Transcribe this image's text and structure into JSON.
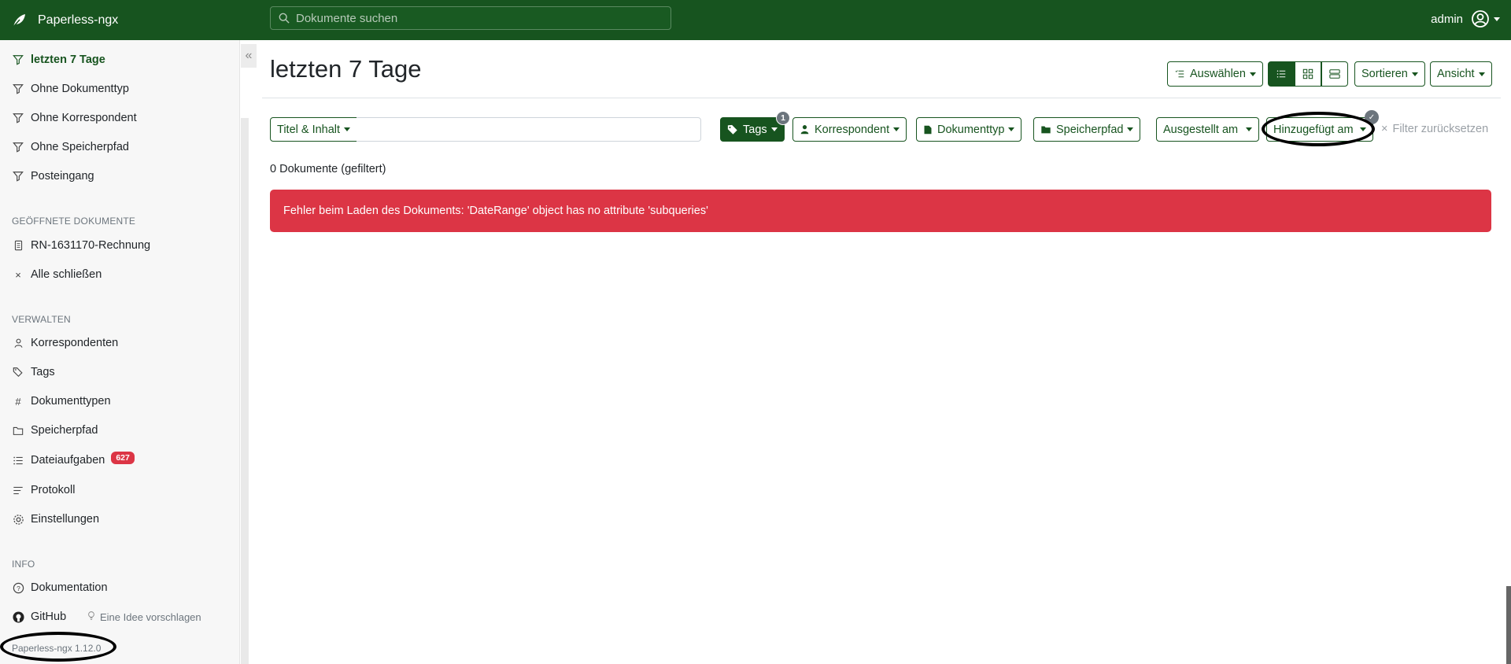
{
  "navbar": {
    "brand": "Paperless-ngx",
    "search_placeholder": "Dokumente suchen",
    "user": "admin"
  },
  "sidebar": {
    "saved_views": [
      {
        "label": "letzten 7 Tage",
        "active": true
      },
      {
        "label": "Ohne Dokumenttyp"
      },
      {
        "label": "Ohne Korrespondent"
      },
      {
        "label": "Ohne Speicherpfad"
      },
      {
        "label": "Posteingang"
      }
    ],
    "open_docs_heading": "GEÖFFNETE DOKUMENTE",
    "open_docs": [
      {
        "label": "RN-1631170-Rechnung"
      },
      {
        "label": "Alle schließen"
      }
    ],
    "manage_heading": "VERWALTEN",
    "manage": [
      {
        "label": "Korrespondenten"
      },
      {
        "label": "Tags"
      },
      {
        "label": "Dokumenttypen"
      },
      {
        "label": "Speicherpfad"
      },
      {
        "label": "Dateiaufgaben",
        "badge": "627"
      },
      {
        "label": "Protokoll"
      },
      {
        "label": "Einstellungen"
      }
    ],
    "info_heading": "INFO",
    "info": [
      {
        "label": "Dokumentation"
      },
      {
        "label": "GitHub"
      }
    ],
    "idea": "Eine Idee vorschlagen",
    "version": "Paperless-ngx 1.12.0"
  },
  "main": {
    "title": "letzten 7 Tage",
    "toolbar": {
      "select": "Auswählen",
      "sort": "Sortieren",
      "view": "Ansicht"
    },
    "filters": {
      "text_mode": "Titel & Inhalt",
      "tags": "Tags",
      "tags_count": "1",
      "correspondent": "Korrespondent",
      "doctype": "Dokumenttyp",
      "storage_path": "Speicherpfad",
      "created": "Ausgestellt am",
      "added": "Hinzugefügt am",
      "reset": "Filter zurücksetzen"
    },
    "doc_count": "0 Dokumente (gefiltert)",
    "error": "Fehler beim Laden des Dokuments: 'DateRange' object has no attribute 'subqueries'"
  },
  "colors": {
    "primary": "#17541f",
    "danger": "#dc3545"
  }
}
